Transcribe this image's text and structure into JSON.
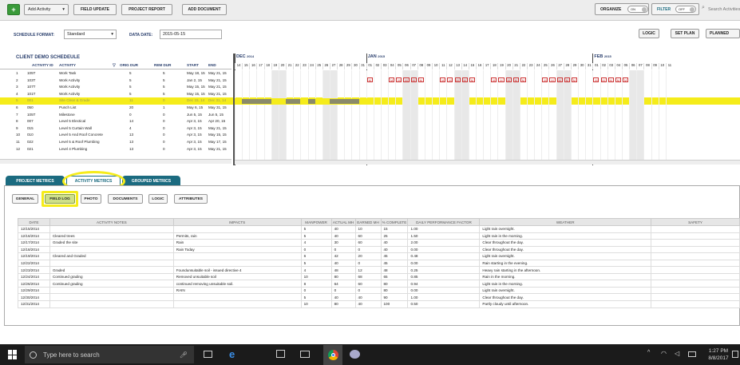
{
  "toolbar": {
    "add_icon": "plus-icon",
    "add_activity": "Add Activity",
    "field_update": "FIELD UPDATE",
    "project_report": "PROJECT REPORT",
    "add_document": "ADD DOCUMENT",
    "organize": "ORGANIZE",
    "organize_toggle": "ON",
    "filter": "FILTER",
    "filter_toggle": "OFF",
    "search_placeholder": "Search Activities"
  },
  "schedule": {
    "format_label": "SCHEDULE FORMAT:",
    "format_value": "Standard",
    "data_date_label": "DATA DATE:",
    "data_date_value": "2015-05-15",
    "logic_btn": "LOGIC",
    "setplan_btn": "SET PLAN",
    "planned_btn": "PLANNED",
    "title": "CLIENT DEMO SCHEDEULE"
  },
  "activity_columns": [
    "ACTIVITY ID",
    "ACTIVITY",
    "ORIG DUR",
    "REM DUR",
    "START",
    "END"
  ],
  "activities": [
    [
      "1",
      "105T",
      "Work Task",
      "5",
      "5",
      "May 18, 15",
      "May 21, 15"
    ],
    [
      "2",
      "103T",
      "Work Activity",
      "5",
      "5",
      "Jan 2, 15",
      "May 21, 15"
    ],
    [
      "3",
      "107T",
      "Work Activity",
      "5",
      "5",
      "May 15, 15",
      "May 21, 15"
    ],
    [
      "4",
      "101T",
      "Work Activity",
      "5",
      "5",
      "May 15, 15",
      "May 21, 15"
    ],
    [
      "5",
      "001",
      "Site Clear & Grade",
      "11",
      "0",
      "Dec 15, 14",
      "Dec 31, 14"
    ],
    [
      "6",
      "050",
      "Punch List",
      "20",
      "1",
      "May 6, 15",
      "May 31, 15"
    ],
    [
      "7",
      "105T",
      "Milestone",
      "0",
      "0",
      "Jun 5, 15",
      "Jun 5, 15"
    ],
    [
      "8",
      "007",
      "Level 5 Electical",
      "14",
      "0",
      "Apr 3, 15",
      "Apr 20, 15"
    ],
    [
      "9",
      "015",
      "Level 5 Curtain Wall",
      "4",
      "0",
      "Apr 3, 15",
      "May 21, 15"
    ],
    [
      "10",
      "010",
      "Level 5 And Roof Concrete",
      "13",
      "0",
      "Apr 3, 15",
      "May 15, 15"
    ],
    [
      "11",
      "022",
      "Level 5 & Roof Plumbing",
      "13",
      "0",
      "Apr 3, 15",
      "May 17, 15"
    ],
    [
      "12",
      "021",
      "Level 4 Plumbing",
      "13",
      "0",
      "Apr 3, 15",
      "May 21, 15"
    ]
  ],
  "gantt": {
    "months": [
      {
        "label": "DEC",
        "year": "2014"
      },
      {
        "label": "JAN",
        "year": "2015"
      },
      {
        "label": "FEB",
        "year": "2015"
      }
    ],
    "dec_days": [
      "14",
      "15",
      "16",
      "17",
      "18",
      "19",
      "20",
      "21",
      "22",
      "23",
      "24",
      "25",
      "26",
      "27",
      "28",
      "29",
      "30",
      "31"
    ],
    "jan_days": [
      "01",
      "02",
      "03",
      "04",
      "05",
      "06",
      "07",
      "08",
      "09",
      "10",
      "11",
      "12",
      "13",
      "14",
      "15",
      "16",
      "17",
      "18",
      "19",
      "20",
      "21",
      "22",
      "23",
      "24",
      "25",
      "26",
      "27",
      "28",
      "29",
      "30",
      "31"
    ],
    "feb_days": [
      "01",
      "02",
      "03",
      "04",
      "05",
      "06",
      "07",
      "08",
      "09",
      "10",
      "11"
    ],
    "bar_marker": "M"
  },
  "metrics_tabs": [
    "PROJECT METRICS",
    "ACTIVITY METRICS",
    "GROUPED METRICS"
  ],
  "sub_tabs": [
    "GENERAL",
    "FIELD LOG",
    "PHOTO",
    "DOCUMENTS",
    "LOGIC",
    "ATTRIBUTES"
  ],
  "log_columns": [
    "DATE",
    "ACTIVITY NOTES",
    "IMPACTS",
    "MANPOWER",
    "ACTUAL MH",
    "EARNED MH",
    "% COMPLETE",
    "DAILY PERFORMANCE FACTOR",
    "WEATHER",
    "SAFETY"
  ],
  "log_rows": [
    [
      "12/15/2014",
      "",
      "",
      "5",
      "40",
      "10",
      "15",
      "1.00",
      "Light rain overnight.",
      ""
    ],
    [
      "12/16/2014",
      "Cleared trees",
      "Permits, rain",
      "5",
      "40",
      "60",
      "25",
      "1.50",
      "Light rain in the morning.",
      ""
    ],
    [
      "12/17/2014",
      "Graded the site",
      "Rain",
      "4",
      "30",
      "60",
      "40",
      "2.00",
      "Clear throughout the day.",
      ""
    ],
    [
      "12/18/2014",
      "",
      "Rain Today",
      "0",
      "0",
      "0",
      "40",
      "0.00",
      "Clear throughout the day.",
      ""
    ],
    [
      "12/19/2014",
      "Cleared and Graded",
      "",
      "6",
      "42",
      "20",
      "45",
      "0.48",
      "Light rain overnight.",
      ""
    ],
    [
      "12/22/2014",
      "",
      "",
      "5",
      "40",
      "0",
      "45",
      "0.00",
      "Rain starting in the evening.",
      ""
    ],
    [
      "12/23/2014",
      "Graded",
      "Foundunsuitable soil - issued directive 4",
      "4",
      "48",
      "12",
      "48",
      "0.25",
      "Heavy rain starting in the afternoon.",
      ""
    ],
    [
      "12/24/2014",
      "Continued grading",
      "Removed unsuitable soil",
      "10",
      "80",
      "68",
      "65",
      "0.85",
      "Rain in the morning.",
      ""
    ],
    [
      "12/26/2014",
      "Continued grading",
      "continued removing unsuitable soil.",
      "8",
      "64",
      "60",
      "80",
      "0.94",
      "Light rain in the morning.",
      ""
    ],
    [
      "12/29/2014",
      "",
      "RAIN",
      "0",
      "0",
      "0",
      "80",
      "0.00",
      "Light rain overnight.",
      ""
    ],
    [
      "12/30/2014",
      "",
      "",
      "5",
      "40",
      "40",
      "90",
      "1.00",
      "Clear throughout the day.",
      ""
    ],
    [
      "12/31/2014",
      "",
      "",
      "10",
      "80",
      "40",
      "100",
      "0.50",
      "Partly cloudy until afternoon.",
      ""
    ]
  ],
  "taskbar": {
    "search_placeholder": "Type here to search",
    "time": "1:27 PM",
    "date": "8/8/2017"
  },
  "colors": {
    "accent": "#1b6b80",
    "highlight": "#f5ec1a",
    "header_text": "#2a3f6d"
  }
}
